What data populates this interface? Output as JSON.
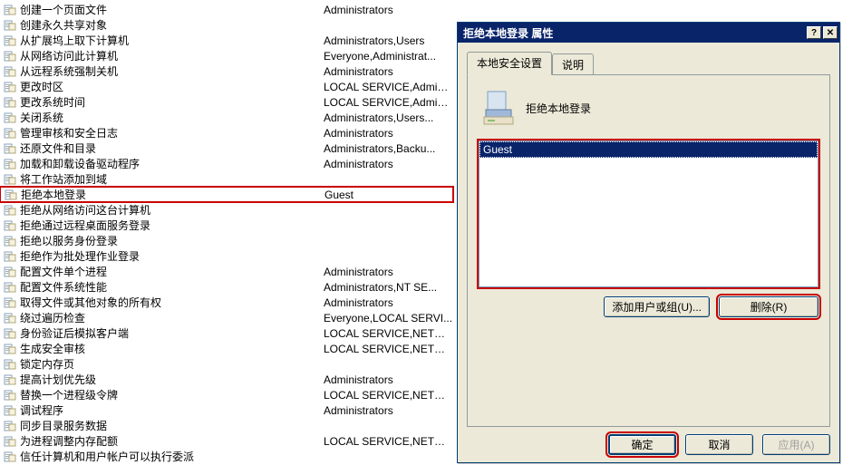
{
  "list": [
    {
      "name": "创建一个页面文件",
      "value": "Administrators"
    },
    {
      "name": "创建永久共享对象",
      "value": ""
    },
    {
      "name": "从扩展坞上取下计算机",
      "value": "Administrators,Users"
    },
    {
      "name": "从网络访问此计算机",
      "value": "Everyone,Administrat..."
    },
    {
      "name": "从远程系统强制关机",
      "value": "Administrators"
    },
    {
      "name": "更改时区",
      "value": "LOCAL SERVICE,Admini..."
    },
    {
      "name": "更改系统时间",
      "value": "LOCAL SERVICE,Admini..."
    },
    {
      "name": "关闭系统",
      "value": "Administrators,Users..."
    },
    {
      "name": "管理审核和安全日志",
      "value": "Administrators"
    },
    {
      "name": "还原文件和目录",
      "value": "Administrators,Backu..."
    },
    {
      "name": "加载和卸载设备驱动程序",
      "value": "Administrators"
    },
    {
      "name": "将工作站添加到域",
      "value": ""
    },
    {
      "name": "拒绝本地登录",
      "value": "Guest",
      "highlight": true
    },
    {
      "name": "拒绝从网络访问这台计算机",
      "value": ""
    },
    {
      "name": "拒绝通过远程桌面服务登录",
      "value": ""
    },
    {
      "name": "拒绝以服务身份登录",
      "value": ""
    },
    {
      "name": "拒绝作为批处理作业登录",
      "value": ""
    },
    {
      "name": "配置文件单个进程",
      "value": "Administrators"
    },
    {
      "name": "配置文件系统性能",
      "value": "Administrators,NT SE..."
    },
    {
      "name": "取得文件或其他对象的所有权",
      "value": "Administrators"
    },
    {
      "name": "绕过遍历检查",
      "value": "Everyone,LOCAL SERVI..."
    },
    {
      "name": "身份验证后模拟客户端",
      "value": "LOCAL SERVICE,NETWOR..."
    },
    {
      "name": "生成安全审核",
      "value": "LOCAL SERVICE,NETWOR..."
    },
    {
      "name": "锁定内存页",
      "value": ""
    },
    {
      "name": "提高计划优先级",
      "value": "Administrators"
    },
    {
      "name": "替换一个进程级令牌",
      "value": "LOCAL SERVICE,NETWOR..."
    },
    {
      "name": "调试程序",
      "value": "Administrators"
    },
    {
      "name": "同步目录服务数据",
      "value": ""
    },
    {
      "name": "为进程调整内存配额",
      "value": "LOCAL SERVICE,NETWOR..."
    },
    {
      "name": "信任计算机和用户帐户可以执行委派",
      "value": ""
    }
  ],
  "dialog": {
    "title": "拒绝本地登录 属性",
    "tabs": {
      "security": "本地安全设置",
      "explain": "说明"
    },
    "header_title": "拒绝本地登录",
    "users": [
      {
        "name": "Guest",
        "selected": true
      }
    ],
    "btn_add": "添加用户或组(U)...",
    "btn_remove": "删除(R)",
    "btn_ok": "确定",
    "btn_cancel": "取消",
    "btn_apply": "应用(A)",
    "help_glyph": "?",
    "close_glyph": "✕"
  }
}
